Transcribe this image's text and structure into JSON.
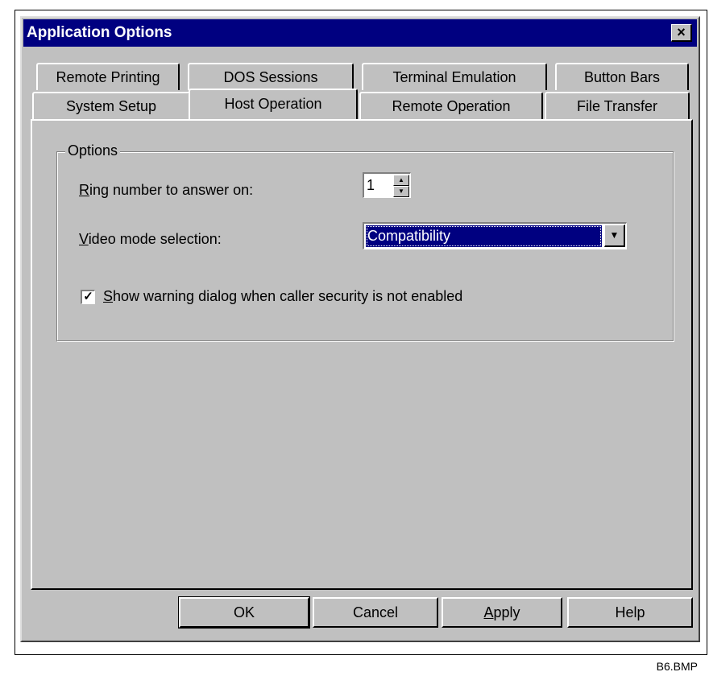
{
  "window": {
    "title": "Application Options",
    "close_label": "×"
  },
  "tabs": {
    "back_row": [
      "Remote Printing",
      "DOS Sessions",
      "Terminal Emulation",
      "Button Bars"
    ],
    "front_row": [
      "System Setup",
      "Host Operation",
      "Remote Operation",
      "File Transfer"
    ],
    "active": "Host Operation"
  },
  "options_group": {
    "title": "Options",
    "ring_label_key": "R",
    "ring_label_rest": "ing number to answer on:",
    "ring_value": "1",
    "video_label_key": "V",
    "video_label_rest": "ideo mode selection:",
    "video_value": "Compatibility",
    "warning_checked": true,
    "warning_label_key": "S",
    "warning_label_rest": "how warning dialog when caller security is not enabled"
  },
  "buttons": {
    "ok": "OK",
    "cancel": "Cancel",
    "apply_key": "A",
    "apply_rest": "pply",
    "help": "Help"
  },
  "caption": "B6.BMP"
}
